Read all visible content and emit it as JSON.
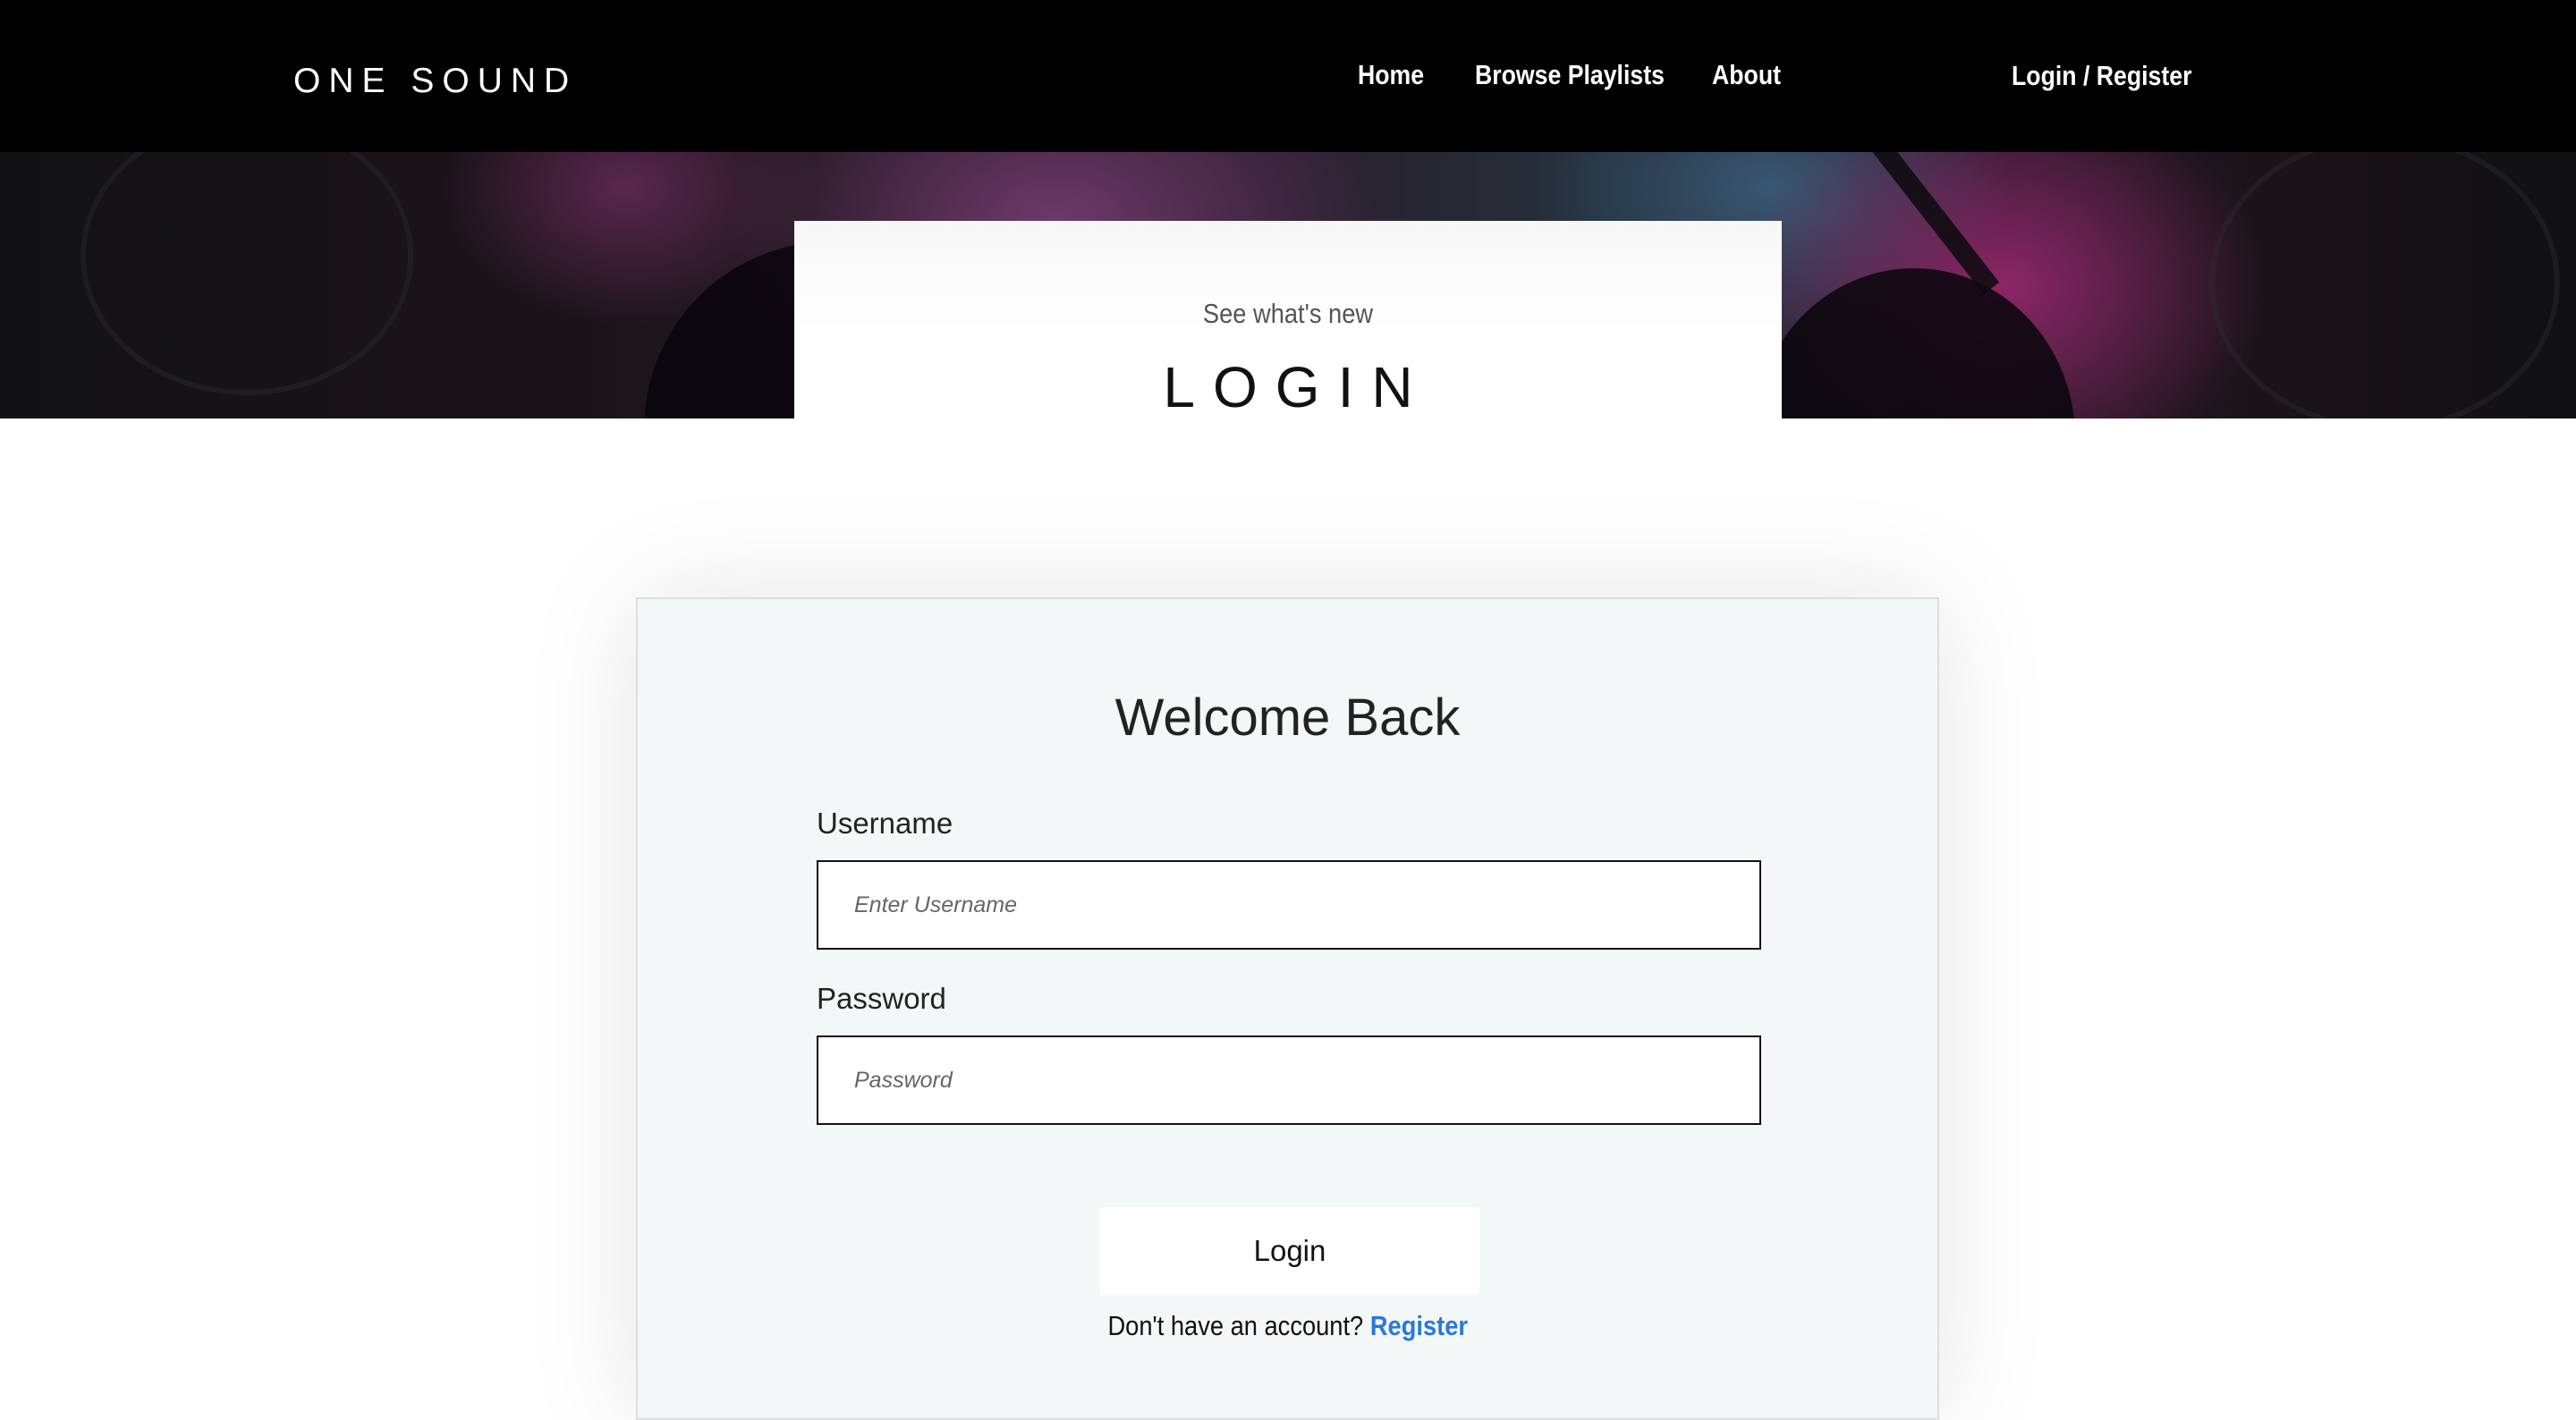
{
  "nav": {
    "brand": "ONE SOUND",
    "links": [
      {
        "label": "Home"
      },
      {
        "label": "Browse Playlists"
      },
      {
        "label": "About"
      }
    ],
    "login_register": "Login / Register"
  },
  "hero": {
    "subtitle": "See what's new",
    "title": "LOGIN"
  },
  "login_form": {
    "heading": "Welcome Back",
    "username_label": "Username",
    "username_placeholder": "Enter Username",
    "password_label": "Password",
    "password_placeholder": "Password",
    "submit_label": "Login",
    "register_prompt": "Don't have an account?",
    "register_link": "Register"
  },
  "colors": {
    "nav_background": "#000000",
    "form_background": "#f4f7f8",
    "link_accent": "#2b78d9"
  }
}
